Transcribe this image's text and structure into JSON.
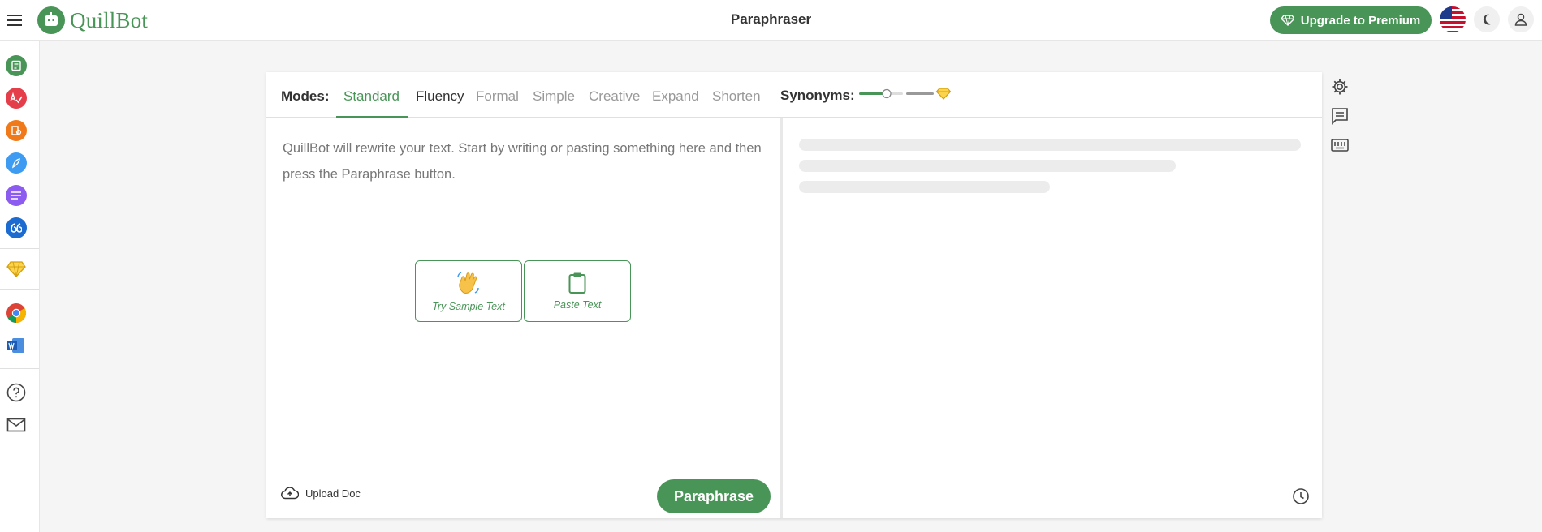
{
  "app": {
    "logo_text": "QuillBot",
    "page_title": "Paraphraser",
    "brand_color": "#499557"
  },
  "header": {
    "upgrade_label": "Upgrade to Premium",
    "icons": [
      "menu-icon",
      "diamond-icon",
      "us-flag-icon",
      "moon-icon",
      "user-icon"
    ]
  },
  "sidebar": {
    "tools": [
      {
        "name": "paraphraser",
        "color": "#499557",
        "icon": "document-icon"
      },
      {
        "name": "grammar-checker",
        "color": "#e53e4b",
        "icon": "spellcheck-icon"
      },
      {
        "name": "plagiarism-checker",
        "color": "#f07a1a",
        "icon": "plagiarism-icon"
      },
      {
        "name": "co-writer",
        "color": "#3d9bf2",
        "icon": "pen-icon"
      },
      {
        "name": "summarizer",
        "color": "#8c5cf0",
        "icon": "lines-icon"
      },
      {
        "name": "citation-generator",
        "color": "#1c6bd1",
        "icon": "quote-icon"
      }
    ],
    "extras": [
      "premium-diamond-icon",
      "chrome-extension-icon",
      "word-addin-icon",
      "help-icon",
      "mail-icon"
    ]
  },
  "modes": {
    "label": "Modes:",
    "tabs": [
      "Standard",
      "Fluency",
      "Formal",
      "Simple",
      "Creative",
      "Expand",
      "Shorten"
    ],
    "active": "Standard",
    "synonyms_label": "Synonyms:",
    "synonyms_level": 0.25
  },
  "input": {
    "placeholder": "QuillBot will rewrite your text. Start by writing or pasting something here and then press the Paraphrase button.",
    "sample_label": "Try Sample Text",
    "paste_label": "Paste Text",
    "upload_label": "Upload Doc",
    "paraphrase_label": "Paraphrase"
  },
  "output": {
    "state": "empty-skeleton"
  },
  "side_tools": [
    "settings-icon",
    "feedback-icon",
    "keyboard-icon"
  ]
}
